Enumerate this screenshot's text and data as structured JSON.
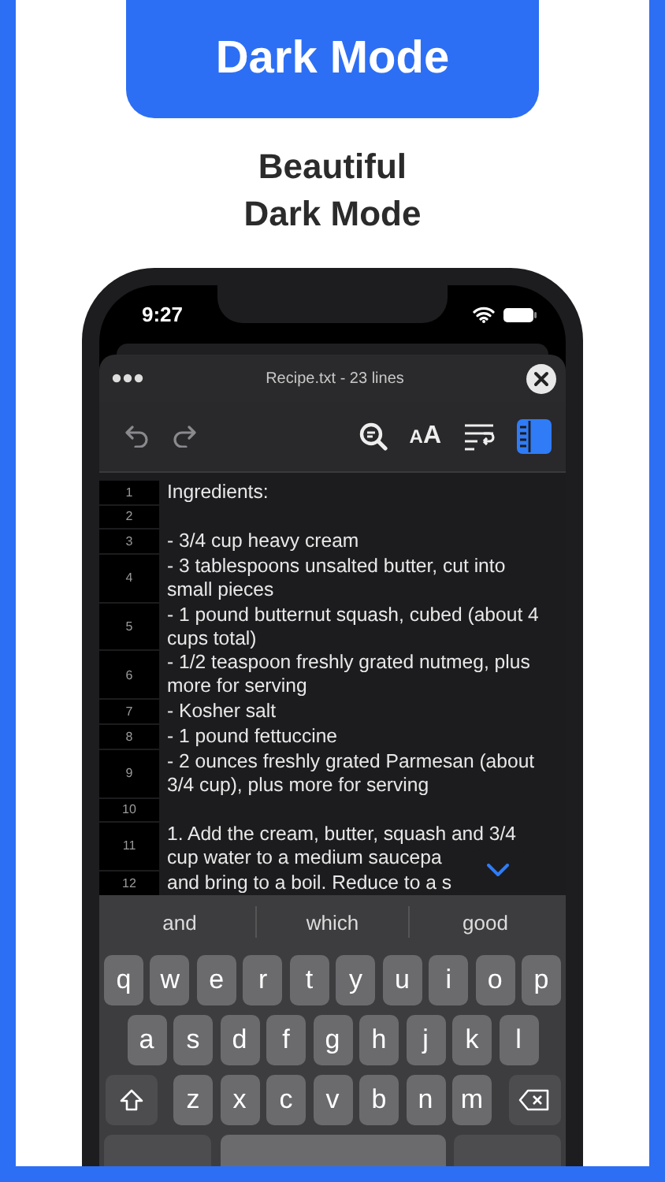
{
  "banner": {
    "title": "Dark Mode"
  },
  "headline": [
    "Beautiful",
    "Dark Mode"
  ],
  "status_bar": {
    "time": "9:27"
  },
  "editor": {
    "title": "Recipe.txt - 23 lines",
    "toolbar": [
      {
        "kind": "undo"
      },
      {
        "kind": "redo"
      },
      {
        "kind": "find"
      },
      {
        "kind": "font-size",
        "small": "A",
        "large": "A"
      },
      {
        "kind": "wrap"
      },
      {
        "kind": "line-numbers",
        "selected": true
      }
    ],
    "lines": [
      {
        "number": "1",
        "text": "Ingredients:"
      },
      {
        "number": "2"
      },
      {
        "number": "3",
        "text": "- 3/4 cup heavy cream"
      },
      {
        "number": "4",
        "text": "- 3 tablespoons unsalted butter, cut into small pieces"
      },
      {
        "number": "5",
        "text": "- 1 pound butternut squash, cubed (about 4 cups total)"
      },
      {
        "number": "6",
        "text": "- 1/2 teaspoon freshly grated nutmeg, plus more for serving"
      },
      {
        "number": "7",
        "text": "- Kosher salt"
      },
      {
        "number": "8",
        "text": "- 1 pound fettuccine"
      },
      {
        "number": "9",
        "text": "- 2 ounces freshly grated Parmesan (about 3/4 cup), plus more for serving"
      },
      {
        "number": "10"
      },
      {
        "number": "11",
        "text_lines": [
          "1. Add the cream, butter, squash and 3/4",
          "cup water to a medium saucepa"
        ]
      },
      {
        "number": "12",
        "text": "and bring to a boil. Reduce to a s"
      }
    ]
  },
  "keyboard": {
    "suggestions": [
      "and",
      "which",
      "good"
    ],
    "rows": [
      [
        "q",
        "w",
        "e",
        "r",
        "t",
        "y",
        "u",
        "i",
        "o",
        "p"
      ],
      [
        "a",
        "s",
        "d",
        "f",
        "g",
        "h",
        "j",
        "k",
        "l"
      ],
      [
        "z",
        "x",
        "c",
        "v",
        "b",
        "n",
        "m"
      ]
    ]
  }
}
